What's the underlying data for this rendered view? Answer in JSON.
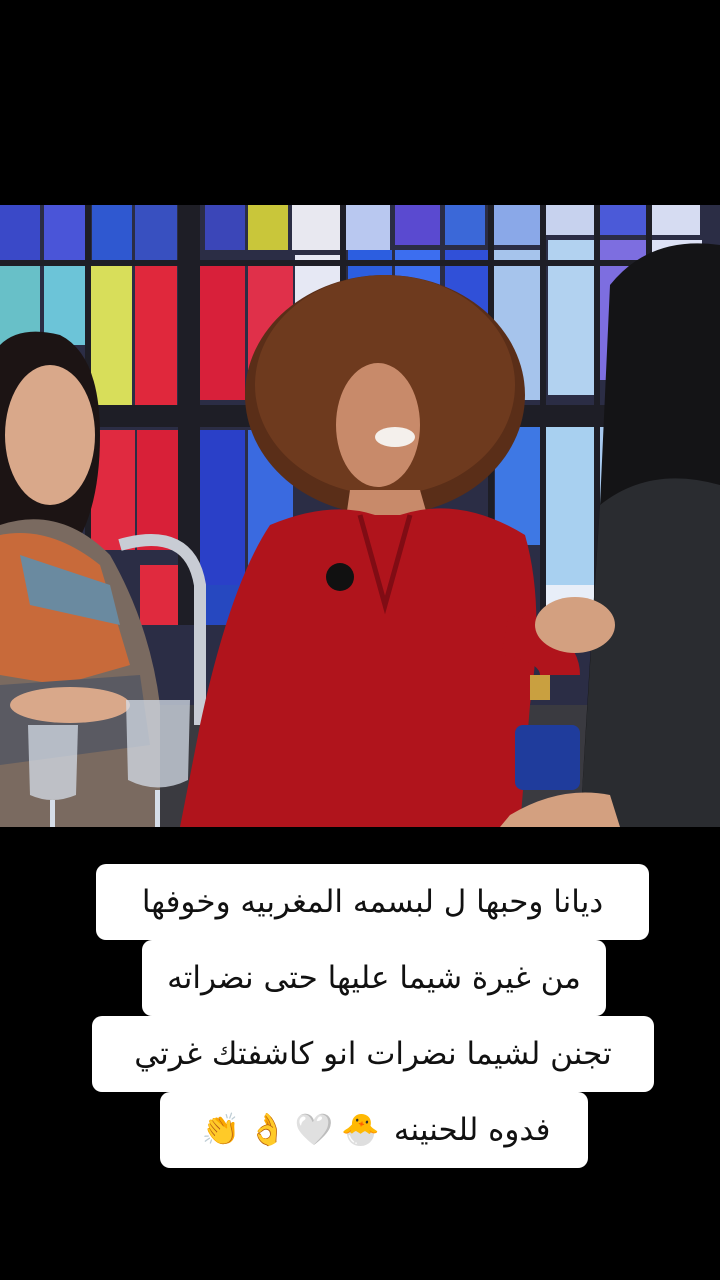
{
  "caption": {
    "line1": "ديانا وحبها ل لبسمه  المغربيه وخوفها",
    "line2": "من غيرة شيما عليها حتى نضراته",
    "line3": "تجنن  لشيما نضرات انو كاشفتك غرتي",
    "line4_text": "فدوه للحنينه",
    "line4_emojis": [
      "🐣",
      "🤍",
      "👌",
      "👏"
    ]
  },
  "colors": {
    "background": "#000000",
    "caption_box": "#ffffff",
    "caption_text": "#111111",
    "shirt_red": "#b0141c"
  }
}
